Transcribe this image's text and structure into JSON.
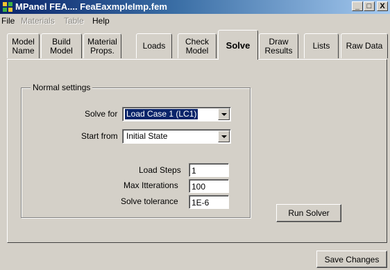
{
  "window": {
    "title": "MPanel FEA....  FeaEaxmpleImp.fem",
    "minimize_label": "_",
    "maximize_label": "□",
    "close_label": "X"
  },
  "menu": [
    {
      "label": "File",
      "enabled": true
    },
    {
      "label": "Materials",
      "enabled": false
    },
    {
      "label": "Table",
      "enabled": false
    },
    {
      "label": "Help",
      "enabled": true
    }
  ],
  "tabs": [
    {
      "label": "Model\nName"
    },
    {
      "label": "Build\nModel"
    },
    {
      "label": "Material\nProps."
    },
    {
      "label": "Loads"
    },
    {
      "label": "Check\nModel"
    },
    {
      "label": "Solve",
      "active": true
    },
    {
      "label": "Draw\nResults"
    },
    {
      "label": "Lists"
    },
    {
      "label": "Raw Data"
    }
  ],
  "solve": {
    "group_label": "Normal settings",
    "solve_for_label": "Solve for",
    "solve_for_value": "Load Case 1  (LC1)",
    "start_from_label": "Start from",
    "start_from_value": "Initial State",
    "load_steps_label": "Load Steps",
    "load_steps_value": "1",
    "max_iterations_label": "Max Itterations",
    "max_iterations_value": "100",
    "solve_tolerance_label": "Solve tolerance",
    "solve_tolerance_value": "1E-6",
    "run_solver_label": "Run Solver"
  },
  "footer": {
    "save_changes_label": "Save Changes"
  },
  "colors": {
    "titlebar_start": "#0a246a",
    "titlebar_end": "#a6caf0",
    "face": "#d4d0c8",
    "selection": "#0a246a"
  }
}
